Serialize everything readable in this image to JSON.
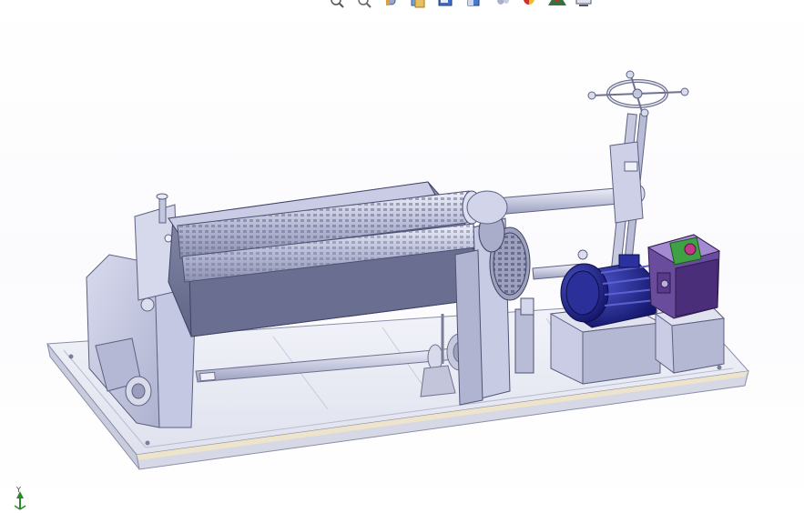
{
  "toolbar": {
    "items": [
      {
        "name": "zoom-to-fit-icon"
      },
      {
        "name": "zoom-to-area-icon"
      },
      {
        "name": "previous-view-icon"
      },
      {
        "name": "section-view-icon"
      },
      {
        "name": "view-orientation-icon"
      },
      {
        "name": "display-style-icon"
      },
      {
        "name": "hide-show-items-icon"
      },
      {
        "name": "edit-appearance-icon"
      },
      {
        "name": "apply-scene-icon"
      },
      {
        "name": "view-settings-icon"
      }
    ]
  },
  "triad": {
    "y_label": "Y"
  },
  "colors": {
    "model_body": "#c9cde6",
    "model_shadow": "#8a8fae",
    "motor_blue": "#23278a",
    "gearbox_purple": "#5a3a8a",
    "base_plate": "#eceef6"
  }
}
